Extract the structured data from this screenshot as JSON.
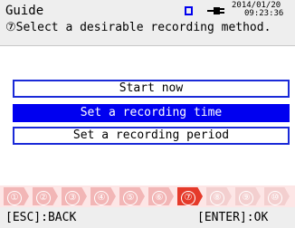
{
  "header": {
    "title": "Guide",
    "date": "2014/01/20",
    "time": "09:23:36",
    "subtitle": "⑦Select a desirable recording method."
  },
  "icons": {
    "storage": "sd-card-icon",
    "power": "ac-power-plug-icon"
  },
  "options": [
    {
      "label": "Start now",
      "selected": false
    },
    {
      "label": "Set a recording time",
      "selected": true
    },
    {
      "label": "Set a recording period",
      "selected": false
    }
  ],
  "steps": {
    "labels": [
      "①",
      "②",
      "③",
      "④",
      "⑤",
      "⑥",
      "⑦",
      "⑧",
      "⑨",
      "⑩"
    ],
    "current": 7
  },
  "footer": {
    "esc_label": "[ESC]:BACK",
    "enter_label": "[ENTER]:OK"
  },
  "colors": {
    "selection": "#0000f0",
    "option_border": "#1a2ad8",
    "step_active": "#e53a2a",
    "step_done": "#f2b6b6",
    "step_future": "#f3cfcf"
  }
}
